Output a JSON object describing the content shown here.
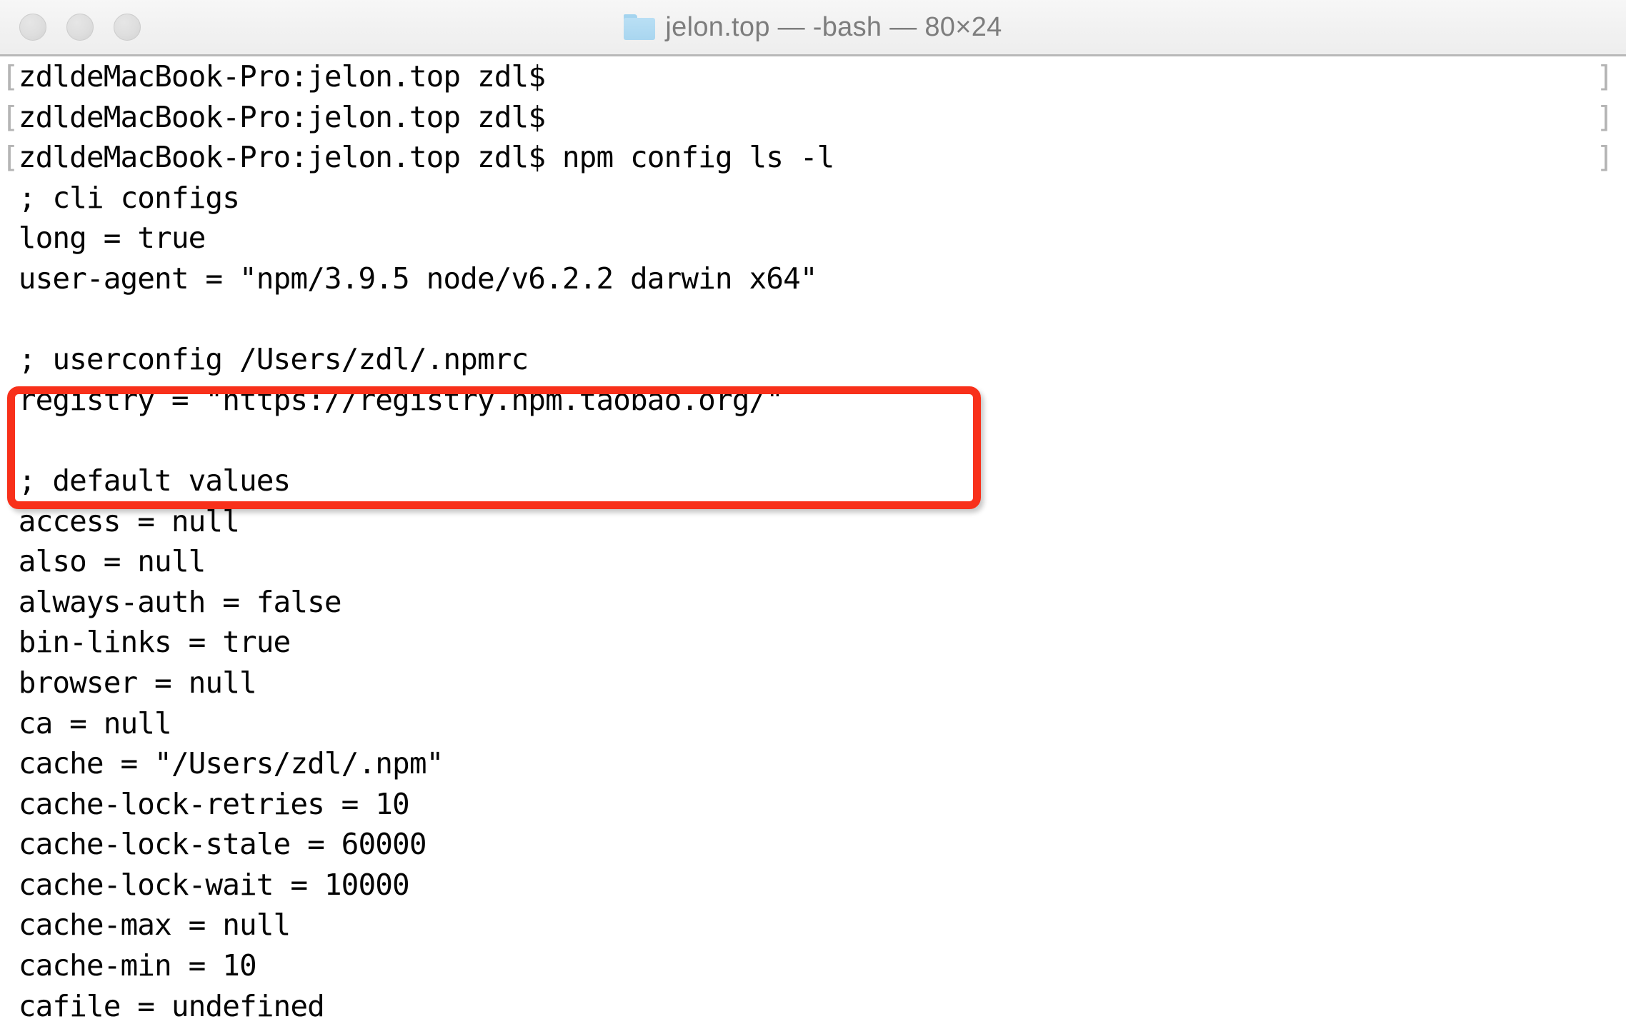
{
  "window": {
    "title": "jelon.top — -bash — 80×24",
    "folder_icon": "folder-icon",
    "traffic_lights": [
      {
        "name": "close-button",
        "label": "Close"
      },
      {
        "name": "minimize-button",
        "label": "Minimize"
      },
      {
        "name": "zoom-button",
        "label": "Zoom"
      }
    ]
  },
  "terminal": {
    "prompt": "[zdldeMacBook-Pro:jelon.top zdl$",
    "bracket_close": "]",
    "lines": [
      {
        "type": "prompt",
        "text": "[zdldeMacBook-Pro:jelon.top zdl$",
        "trailing": "]"
      },
      {
        "type": "prompt",
        "text": "[zdldeMacBook-Pro:jelon.top zdl$",
        "trailing": "]"
      },
      {
        "type": "command",
        "text": "[zdldeMacBook-Pro:jelon.top zdl$ npm config ls -l",
        "trailing": "]"
      },
      {
        "type": "comment",
        "text": " ; cli configs",
        "trailing": ""
      },
      {
        "type": "output",
        "text": " long = true",
        "trailing": ""
      },
      {
        "type": "output",
        "text": " user-agent = \"npm/3.9.5 node/v6.2.2 darwin x64\"",
        "trailing": ""
      },
      {
        "type": "blank",
        "text": "",
        "trailing": ""
      },
      {
        "type": "comment",
        "text": " ; userconfig /Users/zdl/.npmrc",
        "trailing": ""
      },
      {
        "type": "output",
        "text": " registry = \"https://registry.npm.taobao.org/\"",
        "trailing": ""
      },
      {
        "type": "blank",
        "text": "",
        "trailing": ""
      },
      {
        "type": "comment",
        "text": " ; default values",
        "trailing": ""
      },
      {
        "type": "output",
        "text": " access = null",
        "trailing": ""
      },
      {
        "type": "output",
        "text": " also = null",
        "trailing": ""
      },
      {
        "type": "output",
        "text": " always-auth = false",
        "trailing": ""
      },
      {
        "type": "output",
        "text": " bin-links = true",
        "trailing": ""
      },
      {
        "type": "output",
        "text": " browser = null",
        "trailing": ""
      },
      {
        "type": "output",
        "text": " ca = null",
        "trailing": ""
      },
      {
        "type": "output",
        "text": " cache = \"/Users/zdl/.npm\"",
        "trailing": ""
      },
      {
        "type": "output",
        "text": " cache-lock-retries = 10",
        "trailing": ""
      },
      {
        "type": "output",
        "text": " cache-lock-stale = 60000",
        "trailing": ""
      },
      {
        "type": "output",
        "text": " cache-lock-wait = 10000",
        "trailing": ""
      },
      {
        "type": "output",
        "text": " cache-max = null",
        "trailing": ""
      },
      {
        "type": "output",
        "text": " cache-min = 10",
        "trailing": ""
      },
      {
        "type": "output",
        "text": " cafile = undefined",
        "trailing": ""
      }
    ]
  },
  "annotation": {
    "type": "rectangle-highlight",
    "color": "#f8301a",
    "highlighted_lines": [
      "; userconfig /Users/zdl/.npmrc",
      "registry = \"https://registry.npm.taobao.org/\""
    ]
  },
  "colors": {
    "titlebar_bg": "#f2f2f2",
    "titlebar_border": "#b8b8b8",
    "title_text": "#7d7d7d",
    "terminal_bg": "#ffffff",
    "terminal_text": "#050505",
    "bracket_gray": "#b4b4b4",
    "highlight_red": "#f8301a",
    "folder_blue": "#a9d6f0"
  }
}
